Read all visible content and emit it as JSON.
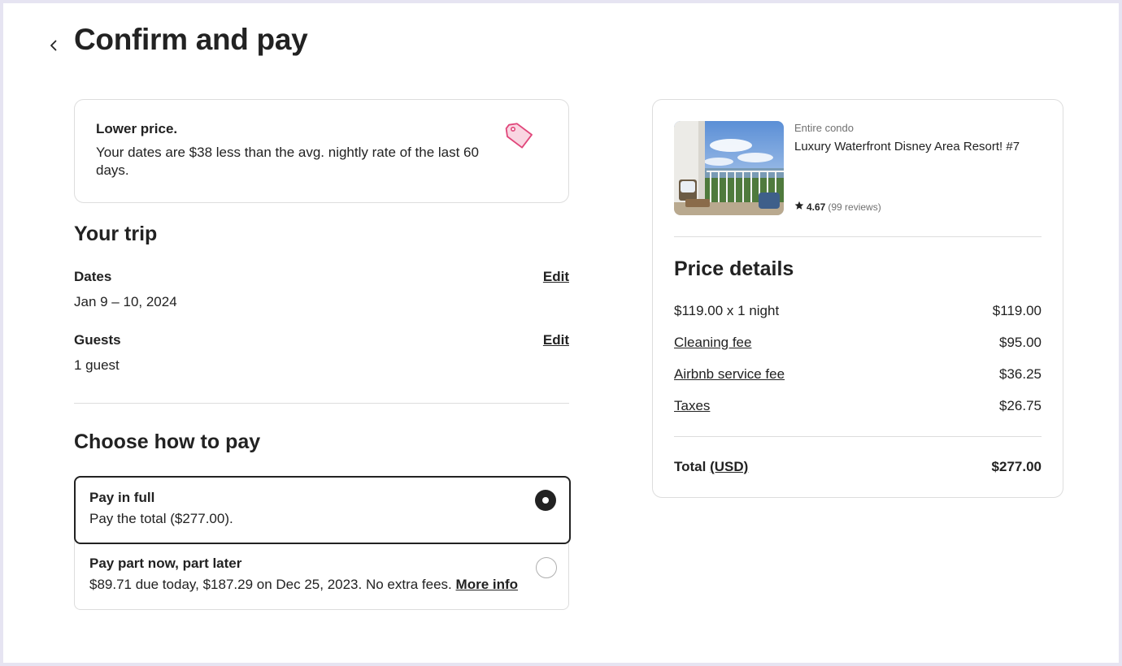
{
  "header": {
    "title": "Confirm and pay"
  },
  "lower_price": {
    "title": "Lower price.",
    "text": "Your dates are $38 less than the avg. nightly rate of the last 60 days."
  },
  "trip": {
    "heading": "Your trip",
    "dates_label": "Dates",
    "dates_value": "Jan 9 – 10, 2024",
    "guests_label": "Guests",
    "guests_value": "1 guest",
    "edit_label": "Edit"
  },
  "payment": {
    "heading": "Choose how to pay",
    "options": [
      {
        "title": "Pay in full",
        "subtitle": "Pay the total ($277.00).",
        "selected": true
      },
      {
        "title": "Pay part now, part later",
        "subtitle": "$89.71 due today, $187.29 on Dec 25, 2023. No extra fees.",
        "link": "More info",
        "selected": false
      }
    ]
  },
  "listing": {
    "type": "Entire condo",
    "title": "Luxury Waterfront Disney Area Resort! #7",
    "rating": "4.67",
    "reviews": "(99 reviews)"
  },
  "price_details": {
    "heading": "Price details",
    "rows": [
      {
        "label": "$119.00 x 1 night",
        "amount": "$119.00"
      },
      {
        "label": "Cleaning fee",
        "amount": "$95.00"
      },
      {
        "label": "Airbnb service fee",
        "amount": "$36.25"
      },
      {
        "label": "Taxes",
        "amount": "$26.75"
      }
    ],
    "total_label": "Total",
    "currency": "(USD)",
    "total_amount": "$277.00"
  },
  "colors": {
    "text": "#222222",
    "muted": "#717171",
    "border": "#dddddd",
    "tag_icon": "#e0467a",
    "page_outer": "#e6e4f2"
  },
  "icons": {
    "back": "chevron-left-icon",
    "tag": "price-tag-icon",
    "star": "star-icon"
  }
}
